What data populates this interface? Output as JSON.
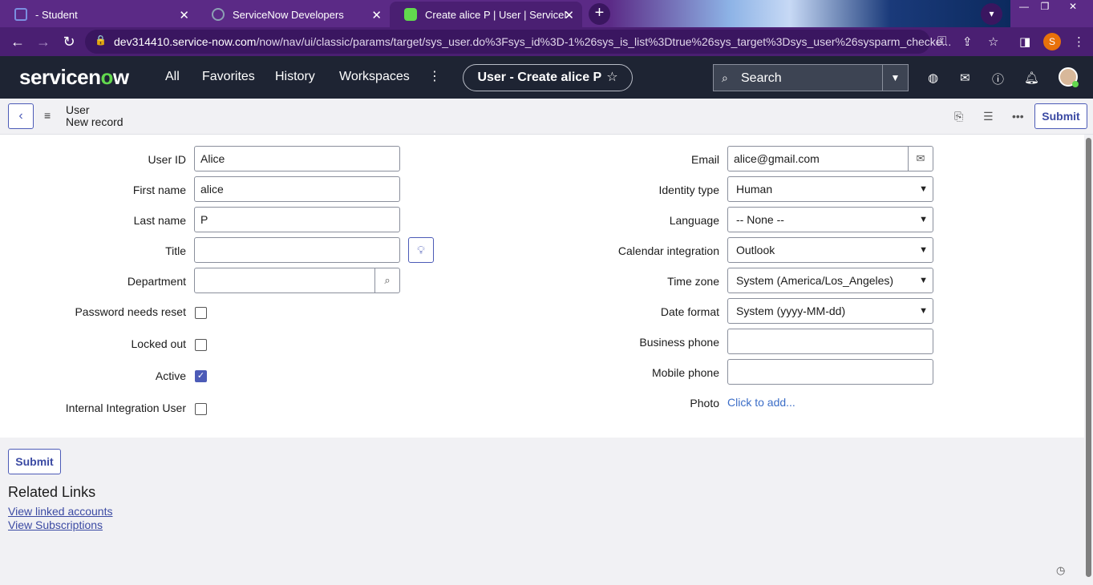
{
  "browser": {
    "tabs": [
      {
        "title": "- Student",
        "favicon_color": "#7b8fe0"
      },
      {
        "title": "ServiceNow Developers",
        "favicon_color": "#8da0b4"
      },
      {
        "title": "Create alice P | User | ServiceNow",
        "favicon_color": "#62d84e"
      }
    ],
    "new_tab_symbol": "+",
    "url_host": "dev314410.service-now.com",
    "url_path": "/now/nav/ui/classic/params/target/sys_user.do%3Fsys_id%3D-1%26sys_is_list%3Dtrue%26sys_target%3Dsys_user%26sysparm_checke...",
    "profile_initial": "S"
  },
  "header": {
    "logo_left": "servicen",
    "logo_o": "o",
    "logo_right": "w",
    "nav": [
      "All",
      "Favorites",
      "History",
      "Workspaces"
    ],
    "context_pill": "User - Create alice P",
    "search_placeholder": "Search"
  },
  "form_header": {
    "table": "User",
    "subtitle": "New record",
    "submit_label": "Submit"
  },
  "form": {
    "left": {
      "user_id": {
        "label": "User ID",
        "value": "Alice"
      },
      "first_name": {
        "label": "First name",
        "value": "alice"
      },
      "last_name": {
        "label": "Last name",
        "value": "P"
      },
      "title": {
        "label": "Title",
        "value": ""
      },
      "department": {
        "label": "Department",
        "value": ""
      },
      "password_needs_reset": {
        "label": "Password needs reset",
        "checked": false
      },
      "locked_out": {
        "label": "Locked out",
        "checked": false
      },
      "active": {
        "label": "Active",
        "checked": true
      },
      "internal_integration_user": {
        "label": "Internal Integration User",
        "checked": false
      }
    },
    "right": {
      "email": {
        "label": "Email",
        "value": "alice@gmail.com"
      },
      "identity_type": {
        "label": "Identity type",
        "value": "Human"
      },
      "language": {
        "label": "Language",
        "value": "-- None --"
      },
      "calendar_integration": {
        "label": "Calendar integration",
        "value": "Outlook"
      },
      "time_zone": {
        "label": "Time zone",
        "value": "System (America/Los_Angeles)"
      },
      "date_format": {
        "label": "Date format",
        "value": "System (yyyy-MM-dd)"
      },
      "business_phone": {
        "label": "Business phone",
        "value": ""
      },
      "mobile_phone": {
        "label": "Mobile phone",
        "value": ""
      },
      "photo": {
        "label": "Photo",
        "link": "Click to add..."
      }
    }
  },
  "bottom": {
    "submit_label": "Submit",
    "related_links_title": "Related Links",
    "links": [
      "View linked accounts",
      "View Subscriptions"
    ]
  },
  "colors": {
    "browser_frame": "#5b2a86",
    "sn_header": "#1e2433",
    "accent": "#4c5bb7",
    "logo_green": "#62d84e"
  }
}
